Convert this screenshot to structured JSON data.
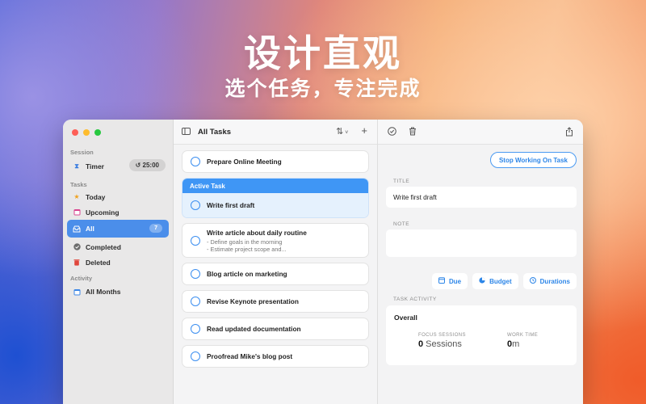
{
  "hero": {
    "title": "设计直观",
    "subtitle": "选个任务，专注完成"
  },
  "sidebar": {
    "session_label": "Session",
    "timer_label": "Timer",
    "timer_value": "25:00",
    "tasks_label": "Tasks",
    "items": [
      {
        "label": "Today",
        "icon": "star-icon",
        "color": "#f0a11c"
      },
      {
        "label": "Upcoming",
        "icon": "calendar-icon",
        "color": "#d9458f"
      },
      {
        "label": "All",
        "icon": "tray-icon",
        "count": "7",
        "active": true
      },
      {
        "label": "Completed",
        "icon": "check-circle-icon",
        "color": "#6d6d6d"
      },
      {
        "label": "Deleted",
        "icon": "trash-icon",
        "color": "#e0463c"
      }
    ],
    "activity_label": "Activity",
    "activity_item": "All Months"
  },
  "list": {
    "title": "All Tasks",
    "tasks": [
      {
        "title": "Prepare Online Meeting"
      }
    ],
    "active_header": "Active Task",
    "active_task": "Write first draft",
    "multi_task": {
      "title": "Write article about daily routine",
      "lines": [
        "- Define goals in the morning",
        "- Estimate project scope and..."
      ]
    },
    "more_tasks": [
      "Blog article on marketing",
      "Revise Keynote presentation",
      "Read updated documentation",
      "Proofread Mike's blog post"
    ]
  },
  "detail": {
    "stop_button": "Stop Working On Task",
    "title_label": "TITLE",
    "title_value": "Write first draft",
    "note_label": "NOTE",
    "chips": [
      "Due",
      "Budget",
      "Durations"
    ],
    "activity_label": "TASK ACTIVITY",
    "overall": "Overall",
    "focus_label": "FOCUS SESSIONS",
    "focus_value": "0",
    "focus_unit": " Sessions",
    "work_label": "WORK TIME",
    "work_value": "0",
    "work_unit": "m"
  },
  "colors": {
    "accent": "#3f96f5",
    "sidebar_active": "#4b8eea"
  }
}
